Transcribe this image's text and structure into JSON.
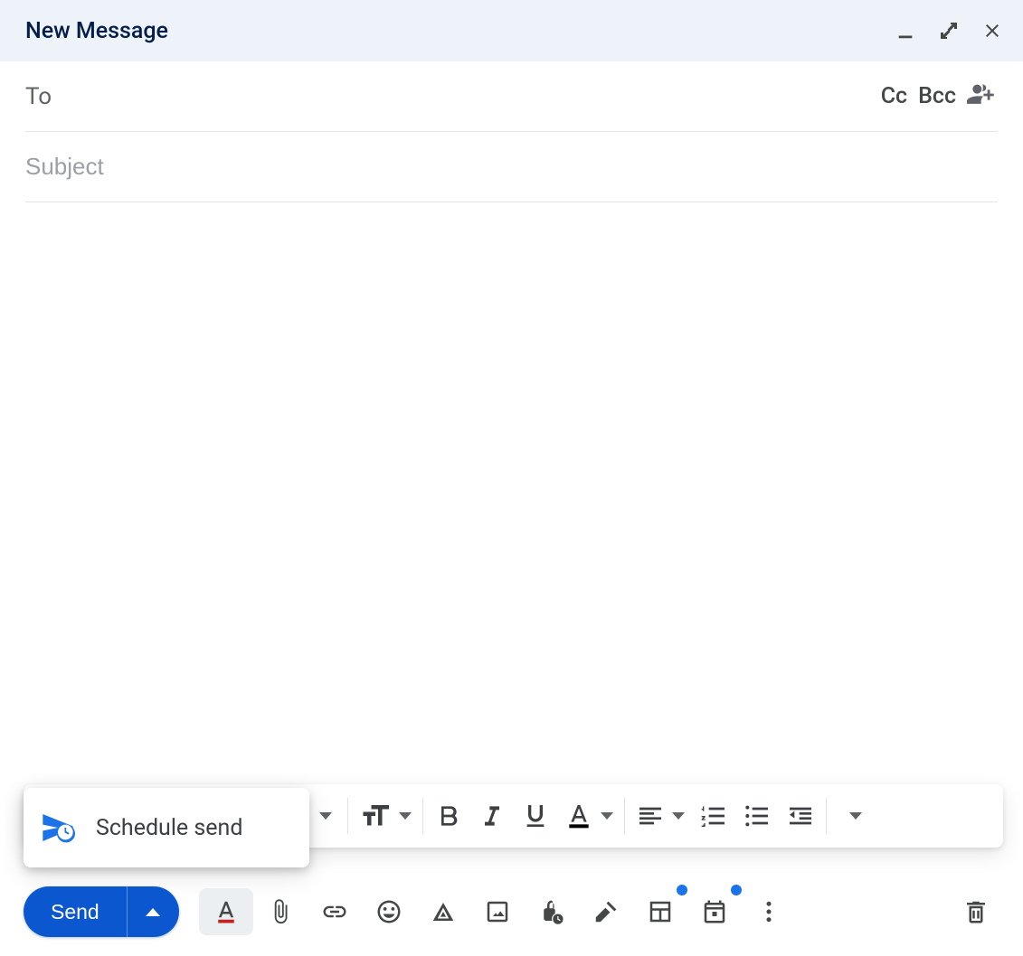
{
  "header": {
    "title": "New Message"
  },
  "fields": {
    "to_label": "To",
    "cc": "Cc",
    "bcc": "Bcc",
    "subject_placeholder": "Subject"
  },
  "schedule": {
    "label": "Schedule send"
  },
  "send": {
    "label": "Send"
  },
  "icons": {
    "minimize": "minimize-icon",
    "expand": "expand-icon",
    "close": "close-icon",
    "add_contacts": "add-contacts-icon",
    "font_size": "font-size-icon",
    "bold": "bold-icon",
    "italic": "italic-icon",
    "underline": "underline-icon",
    "text_color": "text-color-icon",
    "align": "align-icon",
    "numbered_list": "numbered-list-icon",
    "bulleted_list": "bulleted-list-icon",
    "outdent": "outdent-icon",
    "more_formatting": "more-formatting-icon",
    "formatting_options": "text-format-icon",
    "attach": "attachment-icon",
    "link": "link-icon",
    "emoji": "emoji-icon",
    "drive": "drive-icon",
    "image": "image-icon",
    "confidential": "confidential-mode-icon",
    "signature": "signature-icon",
    "layout": "select-layout-icon",
    "calendar": "calendar-icon",
    "more": "more-options-icon",
    "trash": "discard-draft-icon",
    "schedule": "schedule-send-icon"
  }
}
